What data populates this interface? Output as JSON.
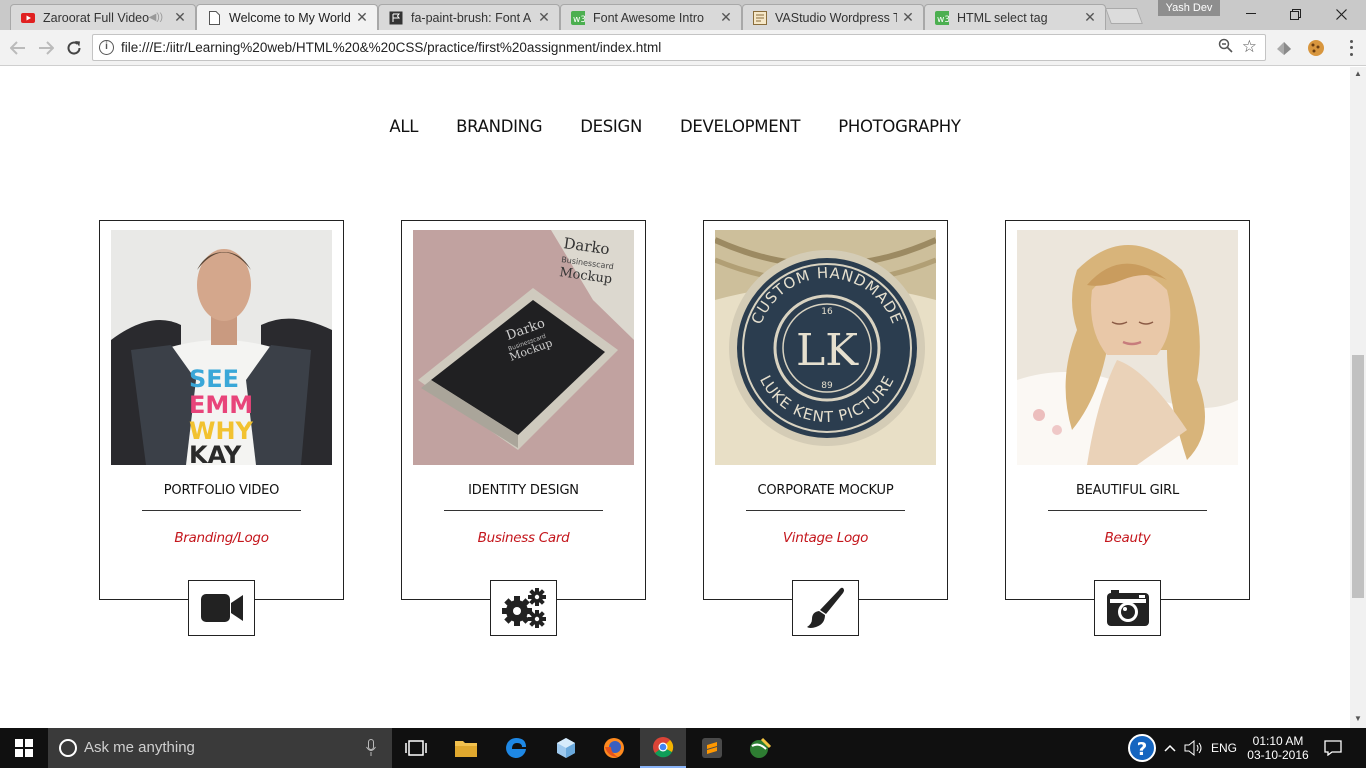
{
  "browser": {
    "tabs": [
      {
        "title": "Zaroorat Full Video",
        "favicon": "youtube-icon",
        "active": false
      },
      {
        "title": "Welcome to My World",
        "favicon": "page-icon",
        "active": true
      },
      {
        "title": "fa-paint-brush: Font A",
        "favicon": "flag-icon",
        "active": false
      },
      {
        "title": "Font Awesome Intro",
        "favicon": "w3-icon",
        "active": false
      },
      {
        "title": "VAStudio Wordpress Te",
        "favicon": "theme-icon",
        "active": false
      },
      {
        "title": "HTML select tag",
        "favicon": "w3-icon",
        "active": false
      }
    ],
    "user": "Yash Dev",
    "url": "file:///E:/iitr/Learning%20web/HTML%20&%20CSS/practice/first%20assignment/index.html"
  },
  "filters": [
    "ALL",
    "BRANDING",
    "DESIGN",
    "DEVELOPMENT",
    "PHOTOGRAPHY"
  ],
  "portfolio": [
    {
      "title": "PORTFOLIO VIDEO",
      "category": "Branding/Logo",
      "icon": "video-camera-icon"
    },
    {
      "title": "IDENTITY DESIGN",
      "category": "Business Card",
      "icon": "gears-icon"
    },
    {
      "title": "CORPORATE MOCKUP",
      "category": "Vintage Logo",
      "icon": "paint-brush-icon"
    },
    {
      "title": "BEAUTIFUL GIRL",
      "category": "Beauty",
      "icon": "camera-icon"
    }
  ],
  "photo_text": {
    "shirt": [
      "SEE",
      "EMM",
      "WHY",
      "KAY"
    ],
    "box_lid": [
      "Darko",
      "Businesscard",
      "Mockup"
    ],
    "box_card": [
      "Darko",
      "Businesscard",
      "Mockup"
    ],
    "badge_top": "CUSTOM HANDMADE",
    "badge_monogram": "LK",
    "badge_num_top": "16",
    "badge_num_bottom": "89",
    "badge_bottom": "LUKE KENT PICTURE"
  },
  "colors": {
    "accent": "#c4161c",
    "text": "#111111",
    "taskbar": "#101010"
  },
  "taskbar": {
    "search_placeholder": "Ask me anything",
    "language": "ENG",
    "time": "01:10 AM",
    "date": "03-10-2016"
  }
}
